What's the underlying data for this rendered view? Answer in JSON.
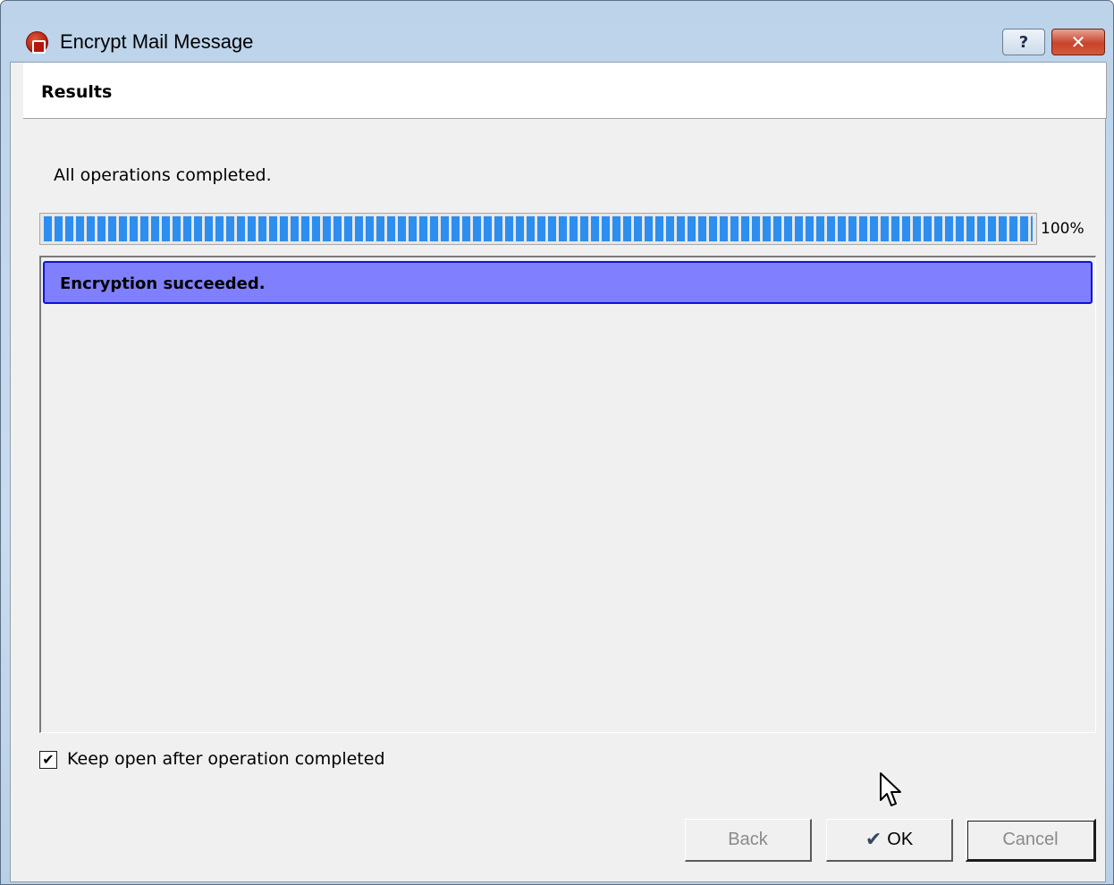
{
  "window": {
    "title": "Encrypt Mail Message",
    "help_label": "?",
    "close_label": "✕"
  },
  "header": {
    "title": "Results"
  },
  "status": {
    "text": "All operations completed."
  },
  "progress": {
    "value_percent": 100,
    "label": "100%"
  },
  "results": {
    "items": [
      {
        "text": "Encryption succeeded.",
        "selected": true
      }
    ]
  },
  "options": {
    "keep_open_checked": true,
    "keep_open_label": "Keep open after operation completed"
  },
  "buttons": {
    "back": "Back",
    "ok": "OK",
    "cancel": "Cancel",
    "back_enabled": false,
    "cancel_enabled": false
  },
  "icons": {
    "app": "encrypt-app-icon",
    "ok": "checkmark-icon",
    "pointer": "mouse-cursor-icon"
  },
  "colors": {
    "selection_fill": "#8080ff",
    "selection_border": "#0b15d8",
    "progress_fill": "#2d8ef0"
  }
}
